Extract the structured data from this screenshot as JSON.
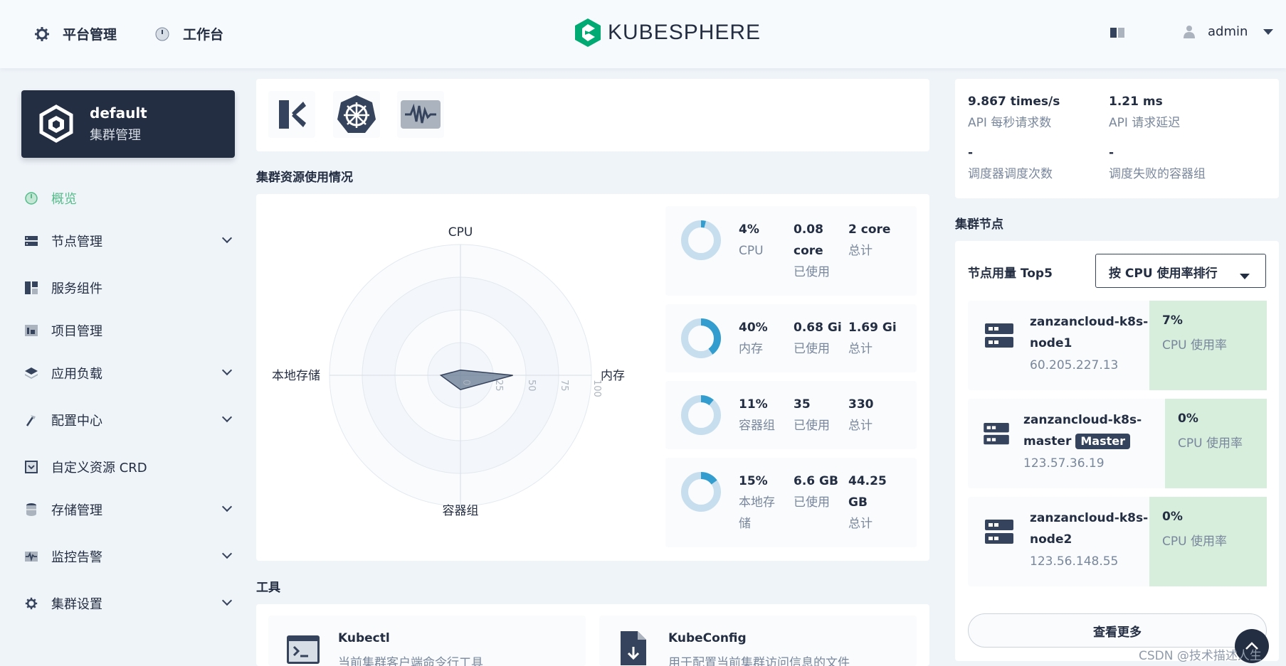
{
  "header": {
    "nav_platform": "平台管理",
    "nav_workbench": "工作台",
    "logo_text": "KUBESPHERE",
    "user": "admin"
  },
  "sidebar": {
    "cluster_name": "default",
    "cluster_sub": "集群管理",
    "items": [
      {
        "label": "概览",
        "icon": "dashboard-icon",
        "expandable": false
      },
      {
        "label": "节点管理",
        "icon": "server-icon",
        "expandable": true
      },
      {
        "label": "服务组件",
        "icon": "components-icon",
        "expandable": false
      },
      {
        "label": "项目管理",
        "icon": "project-icon",
        "expandable": false
      },
      {
        "label": "应用负载",
        "icon": "layers-icon",
        "expandable": true
      },
      {
        "label": "配置中心",
        "icon": "hammer-icon",
        "expandable": true
      },
      {
        "label": "自定义资源 CRD",
        "icon": "crd-icon",
        "expandable": false
      },
      {
        "label": "存储管理",
        "icon": "database-icon",
        "expandable": true
      },
      {
        "label": "监控告警",
        "icon": "monitor-icon",
        "expandable": true
      },
      {
        "label": "集群设置",
        "icon": "gear-icon",
        "expandable": true
      }
    ]
  },
  "resources": {
    "title": "集群资源使用情况",
    "radar": {
      "axes": [
        "CPU",
        "内存",
        "容器组",
        "本地存储"
      ],
      "ticks": [
        "0",
        "25",
        "50",
        "75",
        "100"
      ],
      "values": [
        4,
        40,
        11,
        15
      ]
    },
    "stats": [
      {
        "percent": "4%",
        "name": "CPU",
        "used_value": "0.08",
        "used_value2": "core",
        "used_label": "已使用",
        "total_value": "2 core",
        "total_label": "总计",
        "fraction": 0.04
      },
      {
        "percent": "40%",
        "name": "内存",
        "used_value": "0.68 Gi",
        "used_label": "已使用",
        "total_value": "1.69 Gi",
        "total_label": "总计",
        "fraction": 0.4
      },
      {
        "percent": "11%",
        "name": "容器组",
        "used_value": "35",
        "used_label": "已使用",
        "total_value": "330",
        "total_label": "总计",
        "fraction": 0.11
      },
      {
        "percent": "15%",
        "name": "本地存",
        "name2": "储",
        "used_value": "6.6 GB",
        "used_label": "已使用",
        "total_value": "44.25",
        "total_value2": "GB",
        "total_label": "总计",
        "fraction": 0.15
      }
    ]
  },
  "tools": {
    "title": "工具",
    "items": [
      {
        "name": "Kubectl",
        "desc": "当前集群客户端命令行工具"
      },
      {
        "name": "KubeConfig",
        "desc": "用于配置当前集群访问信息的文件"
      }
    ]
  },
  "kpis": [
    {
      "value": "9.867 times/s",
      "label": "API 每秒请求数"
    },
    {
      "value": "1.21 ms",
      "label": "API 请求延迟"
    },
    {
      "value": "-",
      "label": "调度器调度次数"
    },
    {
      "value": "-",
      "label": "调度失败的容器组"
    }
  ],
  "nodes": {
    "title": "集群节点",
    "top_label": "节点用量 Top5",
    "sort_select": "按 CPU 使用率排行",
    "items": [
      {
        "name1": "zanzancloud-k8s-",
        "name2": "node1",
        "ip": "60.205.227.13",
        "pct": "7%",
        "pct_label": "CPU 使用率"
      },
      {
        "name1": "zanzancloud-k8s-",
        "name2": "master",
        "badge": "Master",
        "ip": "123.57.36.19",
        "pct": "0%",
        "pct_label": "CPU 使用率"
      },
      {
        "name1": "zanzancloud-k8s-",
        "name2": "node2",
        "ip": "123.56.148.55",
        "pct": "0%",
        "pct_label": "CPU 使用率"
      }
    ],
    "more_button": "查看更多"
  },
  "watermark": "CSDN @技术描述人生",
  "colors": {
    "accent": "#55bc8a",
    "donut_fill": "#329dce",
    "donut_track": "#c7deef",
    "dark": "#242e42"
  }
}
